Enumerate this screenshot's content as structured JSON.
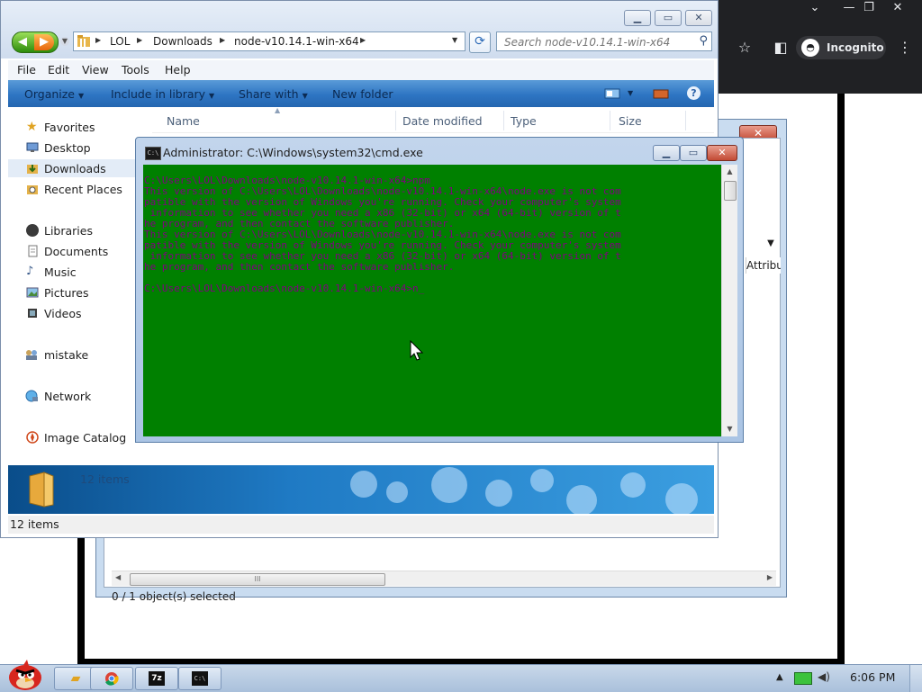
{
  "chrome": {
    "incognito_label": "Incognito",
    "controls": [
      "⌄",
      "—",
      "❐",
      "✕"
    ]
  },
  "zip_window": {
    "status": "0 / 1 object(s) selected",
    "attributes_col": "Attribute",
    "scroll_grip": "III"
  },
  "explorer": {
    "address": {
      "crumbs": [
        "LOL",
        "Downloads",
        "node-v10.14.1-win-x64"
      ]
    },
    "search_placeholder": "Search node-v10.14.1-win-x64",
    "menu": [
      "File",
      "Edit",
      "View",
      "Tools",
      "Help"
    ],
    "commands": [
      "Organize",
      "Include in library",
      "Share with",
      "New folder"
    ],
    "nav": {
      "favorites": "Favorites",
      "desktop": "Desktop",
      "downloads": "Downloads",
      "recent": "Recent Places",
      "libraries": "Libraries",
      "documents": "Documents",
      "music": "Music",
      "pictures": "Pictures",
      "videos": "Videos",
      "mistake": "mistake",
      "network": "Network",
      "image_catalog": "Image Catalog"
    },
    "columns": [
      "Name",
      "Date modified",
      "Type",
      "Size"
    ],
    "details_count": "12 items",
    "status_count": "12 items"
  },
  "cmd": {
    "title": "Administrator: C:\\Windows\\system32\\cmd.exe",
    "console_text": "C:\\Users\\LOL\\Downloads\\node-v10.14.1-win-x64>npm\nThis version of C:\\Users\\LOL\\Downloads\\node-v10.14.1-win-x64\\node.exe is not com\npatible with the version of Windows you're running. Check your computer's system\n information to see whether you need a x86 (32-bit) or x64 (64-bit) version of t\nhe program, and then contact the software publisher.\nThis version of C:\\Users\\LOL\\Downloads\\node-v10.14.1-win-x64\\node.exe is not com\npatible with the version of Windows you're running. Check your computer's system\n information to see whether you need a x86 (32-bit) or x64 (64-bit) version of t\nhe program, and then contact the software publisher.\n\nC:\\Users\\LOL\\Downloads\\node-v10.14.1-win-x64>n_",
    "icon_text": "C:\\"
  },
  "taskbar": {
    "clock": "6:06 PM",
    "buttons": [
      "explorer-folder-icon",
      "chrome-icon",
      "7zip-icon",
      "cmd-icon"
    ],
    "zip_label": "7z",
    "cmd_label": "C:\\"
  },
  "colors": {
    "console_bg": "#008000",
    "console_fg": "#800080",
    "cmdbar": "#2e75c3",
    "chrome_dark": "#202124"
  }
}
